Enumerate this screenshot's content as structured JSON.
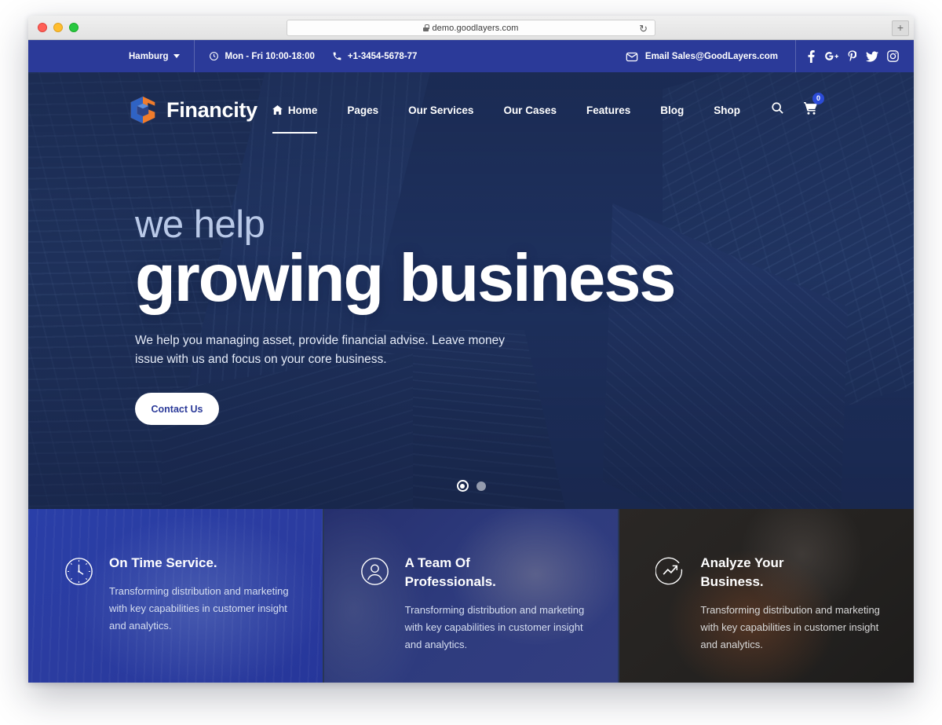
{
  "browser": {
    "url": "demo.goodlayers.com",
    "lock_icon": "lock-icon",
    "reload_icon": "reload-icon",
    "newtab_label": "+"
  },
  "topbar": {
    "city": "Hamburg",
    "hours": "Mon - Fri 10:00-18:00",
    "phone": "+1-3454-5678-77",
    "email": "Email Sales@GoodLayers.com",
    "clock_icon": "clock-icon",
    "phone_icon": "phone-icon",
    "mail_icon": "envelope-icon",
    "socials": [
      {
        "name": "facebook-icon",
        "glyph": "f"
      },
      {
        "name": "google-plus-icon",
        "glyph": "G+"
      },
      {
        "name": "pinterest-icon",
        "glyph": "P"
      },
      {
        "name": "twitter-icon",
        "glyph": "t"
      },
      {
        "name": "instagram-icon",
        "glyph": "ig"
      }
    ]
  },
  "brand": {
    "name": "Financity",
    "logo_icon": "cube-logo-icon"
  },
  "nav": {
    "items": [
      {
        "label": "Home",
        "active": true,
        "icon": "home-icon"
      },
      {
        "label": "Pages",
        "active": false
      },
      {
        "label": "Our Services",
        "active": false
      },
      {
        "label": "Our Cases",
        "active": false
      },
      {
        "label": "Features",
        "active": false
      },
      {
        "label": "Blog",
        "active": false
      },
      {
        "label": "Shop",
        "active": false
      }
    ],
    "search_icon": "search-icon",
    "cart_icon": "cart-icon",
    "cart_count": "0"
  },
  "hero": {
    "pretitle": "we help",
    "title": "growing business",
    "subtitle": "We help you managing asset, provide financial advise. Leave money issue with us and focus on your core business.",
    "cta_label": "Contact Us",
    "slides": [
      {
        "active": true
      },
      {
        "active": false
      }
    ]
  },
  "cards": [
    {
      "icon": "clock-icon",
      "title": "On Time Service.",
      "text": "Transforming distribution and marketing with key capabilities in customer insight and analytics."
    },
    {
      "icon": "user-icon",
      "title": "A Team Of Professionals.",
      "text": "Transforming distribution and marketing with key capabilities in customer insight and analytics."
    },
    {
      "icon": "trending-up-icon",
      "title": "Analyze Your Business.",
      "text": "Transforming distribution and marketing with key capabilities in customer insight and analytics."
    }
  ],
  "colors": {
    "topbar_blue": "#2b3a99",
    "brand_white": "#ffffff",
    "cta_text": "#2b3a99",
    "logo_orange": "#f07c2c",
    "logo_blue": "#2f63c4",
    "card1_bg": "#2b3ca0",
    "card3_bg": "#242220"
  }
}
